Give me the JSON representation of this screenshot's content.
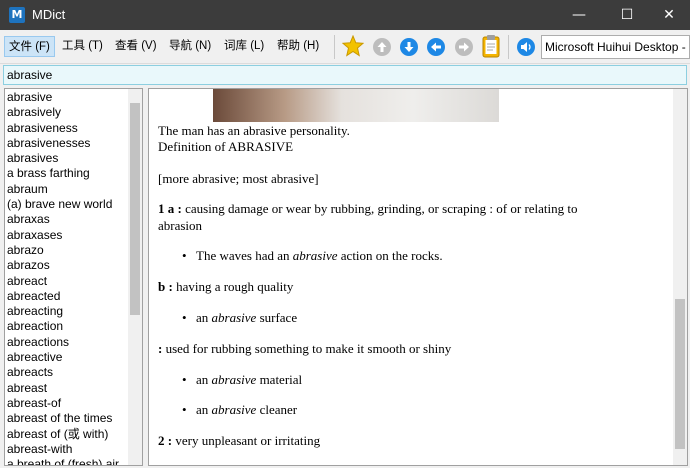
{
  "window": {
    "title": "MDict"
  },
  "menu": [
    "文件 (F)",
    "工具 (T)",
    "查看 (V)",
    "导航 (N)",
    "词库 (L)",
    "帮助 (H)"
  ],
  "toolbar": {
    "font_selected": "Microsoft Huihui Desktop -",
    "colors": {
      "favorite": "#f2c200",
      "nav": "#1e88e5",
      "home": "#9e9e9e",
      "clipboard": "#f4b400"
    }
  },
  "search": {
    "value": "abrasive"
  },
  "wordlist": [
    "abrasive",
    "abrasively",
    "abrasiveness",
    "abrasivenesses",
    "abrasives",
    "a brass farthing",
    "abraum",
    "(a) brave new world",
    "abraxas",
    "abraxases",
    "abrazo",
    "abrazos",
    "abreact",
    "abreacted",
    "abreacting",
    "abreaction",
    "abreactions",
    "abreactive",
    "abreacts",
    "abreast",
    "abreast-of",
    "abreast of the times",
    "abreast of (或 with)",
    "abreast-with",
    "a breath of (fresh) air"
  ],
  "entry": {
    "example_top": "The man has an abrasive personality.",
    "heading": "Definition of ABRASIVE",
    "forms": "[more abrasive; most abrasive]",
    "sense1_label": "1 a :",
    "sense1_text": " causing damage or wear by rubbing, grinding, or scraping : of or relating to",
    "sense1_cont": "abrasion",
    "ex1_pre": "The waves had an ",
    "ex1_em": "abrasive",
    "ex1_post": " action on the rocks.",
    "sense1b_label": "b :",
    "sense1b_text": " having a rough quality",
    "ex2_pre": "an ",
    "ex2_em": "abrasive",
    "ex2_post": " surface",
    "sense1c_label": ":",
    "sense1c_text": " used for rubbing something to make it smooth or shiny",
    "ex3_pre": "an ",
    "ex3_em": "abrasive",
    "ex3_post": " material",
    "ex4_pre": "an ",
    "ex4_em": "abrasive",
    "ex4_post": " cleaner",
    "sense2_label": "2 :",
    "sense2_text": " very unpleasant or irritating",
    "bullet": "•"
  }
}
